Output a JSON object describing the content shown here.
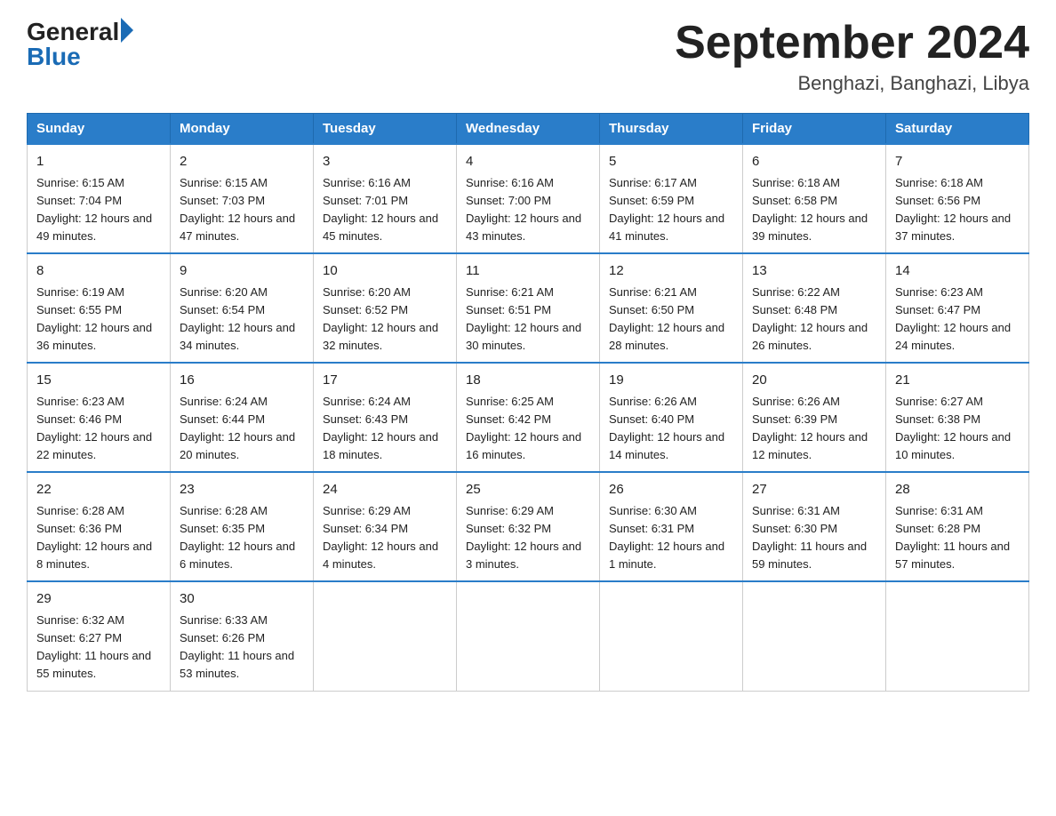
{
  "logo": {
    "general": "General",
    "blue": "Blue"
  },
  "title": "September 2024",
  "location": "Benghazi, Banghazi, Libya",
  "days_of_week": [
    "Sunday",
    "Monday",
    "Tuesday",
    "Wednesday",
    "Thursday",
    "Friday",
    "Saturday"
  ],
  "weeks": [
    [
      {
        "day": "1",
        "sunrise": "Sunrise: 6:15 AM",
        "sunset": "Sunset: 7:04 PM",
        "daylight": "Daylight: 12 hours and 49 minutes."
      },
      {
        "day": "2",
        "sunrise": "Sunrise: 6:15 AM",
        "sunset": "Sunset: 7:03 PM",
        "daylight": "Daylight: 12 hours and 47 minutes."
      },
      {
        "day": "3",
        "sunrise": "Sunrise: 6:16 AM",
        "sunset": "Sunset: 7:01 PM",
        "daylight": "Daylight: 12 hours and 45 minutes."
      },
      {
        "day": "4",
        "sunrise": "Sunrise: 6:16 AM",
        "sunset": "Sunset: 7:00 PM",
        "daylight": "Daylight: 12 hours and 43 minutes."
      },
      {
        "day": "5",
        "sunrise": "Sunrise: 6:17 AM",
        "sunset": "Sunset: 6:59 PM",
        "daylight": "Daylight: 12 hours and 41 minutes."
      },
      {
        "day": "6",
        "sunrise": "Sunrise: 6:18 AM",
        "sunset": "Sunset: 6:58 PM",
        "daylight": "Daylight: 12 hours and 39 minutes."
      },
      {
        "day": "7",
        "sunrise": "Sunrise: 6:18 AM",
        "sunset": "Sunset: 6:56 PM",
        "daylight": "Daylight: 12 hours and 37 minutes."
      }
    ],
    [
      {
        "day": "8",
        "sunrise": "Sunrise: 6:19 AM",
        "sunset": "Sunset: 6:55 PM",
        "daylight": "Daylight: 12 hours and 36 minutes."
      },
      {
        "day": "9",
        "sunrise": "Sunrise: 6:20 AM",
        "sunset": "Sunset: 6:54 PM",
        "daylight": "Daylight: 12 hours and 34 minutes."
      },
      {
        "day": "10",
        "sunrise": "Sunrise: 6:20 AM",
        "sunset": "Sunset: 6:52 PM",
        "daylight": "Daylight: 12 hours and 32 minutes."
      },
      {
        "day": "11",
        "sunrise": "Sunrise: 6:21 AM",
        "sunset": "Sunset: 6:51 PM",
        "daylight": "Daylight: 12 hours and 30 minutes."
      },
      {
        "day": "12",
        "sunrise": "Sunrise: 6:21 AM",
        "sunset": "Sunset: 6:50 PM",
        "daylight": "Daylight: 12 hours and 28 minutes."
      },
      {
        "day": "13",
        "sunrise": "Sunrise: 6:22 AM",
        "sunset": "Sunset: 6:48 PM",
        "daylight": "Daylight: 12 hours and 26 minutes."
      },
      {
        "day": "14",
        "sunrise": "Sunrise: 6:23 AM",
        "sunset": "Sunset: 6:47 PM",
        "daylight": "Daylight: 12 hours and 24 minutes."
      }
    ],
    [
      {
        "day": "15",
        "sunrise": "Sunrise: 6:23 AM",
        "sunset": "Sunset: 6:46 PM",
        "daylight": "Daylight: 12 hours and 22 minutes."
      },
      {
        "day": "16",
        "sunrise": "Sunrise: 6:24 AM",
        "sunset": "Sunset: 6:44 PM",
        "daylight": "Daylight: 12 hours and 20 minutes."
      },
      {
        "day": "17",
        "sunrise": "Sunrise: 6:24 AM",
        "sunset": "Sunset: 6:43 PM",
        "daylight": "Daylight: 12 hours and 18 minutes."
      },
      {
        "day": "18",
        "sunrise": "Sunrise: 6:25 AM",
        "sunset": "Sunset: 6:42 PM",
        "daylight": "Daylight: 12 hours and 16 minutes."
      },
      {
        "day": "19",
        "sunrise": "Sunrise: 6:26 AM",
        "sunset": "Sunset: 6:40 PM",
        "daylight": "Daylight: 12 hours and 14 minutes."
      },
      {
        "day": "20",
        "sunrise": "Sunrise: 6:26 AM",
        "sunset": "Sunset: 6:39 PM",
        "daylight": "Daylight: 12 hours and 12 minutes."
      },
      {
        "day": "21",
        "sunrise": "Sunrise: 6:27 AM",
        "sunset": "Sunset: 6:38 PM",
        "daylight": "Daylight: 12 hours and 10 minutes."
      }
    ],
    [
      {
        "day": "22",
        "sunrise": "Sunrise: 6:28 AM",
        "sunset": "Sunset: 6:36 PM",
        "daylight": "Daylight: 12 hours and 8 minutes."
      },
      {
        "day": "23",
        "sunrise": "Sunrise: 6:28 AM",
        "sunset": "Sunset: 6:35 PM",
        "daylight": "Daylight: 12 hours and 6 minutes."
      },
      {
        "day": "24",
        "sunrise": "Sunrise: 6:29 AM",
        "sunset": "Sunset: 6:34 PM",
        "daylight": "Daylight: 12 hours and 4 minutes."
      },
      {
        "day": "25",
        "sunrise": "Sunrise: 6:29 AM",
        "sunset": "Sunset: 6:32 PM",
        "daylight": "Daylight: 12 hours and 3 minutes."
      },
      {
        "day": "26",
        "sunrise": "Sunrise: 6:30 AM",
        "sunset": "Sunset: 6:31 PM",
        "daylight": "Daylight: 12 hours and 1 minute."
      },
      {
        "day": "27",
        "sunrise": "Sunrise: 6:31 AM",
        "sunset": "Sunset: 6:30 PM",
        "daylight": "Daylight: 11 hours and 59 minutes."
      },
      {
        "day": "28",
        "sunrise": "Sunrise: 6:31 AM",
        "sunset": "Sunset: 6:28 PM",
        "daylight": "Daylight: 11 hours and 57 minutes."
      }
    ],
    [
      {
        "day": "29",
        "sunrise": "Sunrise: 6:32 AM",
        "sunset": "Sunset: 6:27 PM",
        "daylight": "Daylight: 11 hours and 55 minutes."
      },
      {
        "day": "30",
        "sunrise": "Sunrise: 6:33 AM",
        "sunset": "Sunset: 6:26 PM",
        "daylight": "Daylight: 11 hours and 53 minutes."
      },
      null,
      null,
      null,
      null,
      null
    ]
  ]
}
